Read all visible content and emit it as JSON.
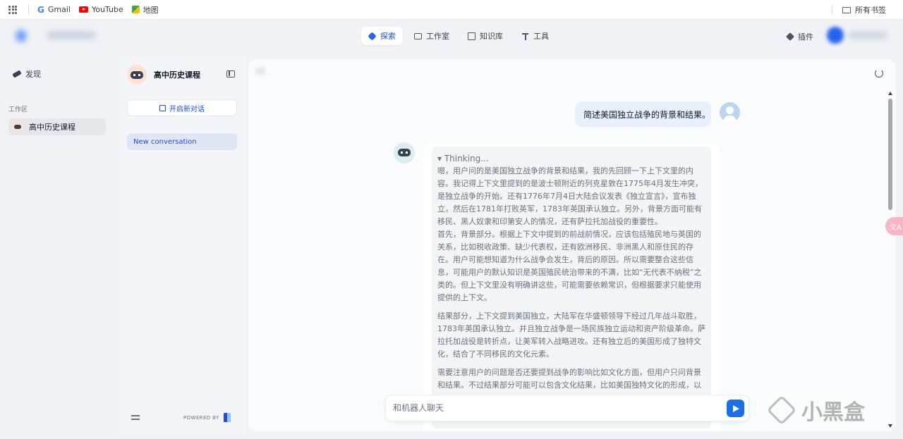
{
  "bookmarks": {
    "items": [
      {
        "label": "Gmail",
        "icon": "gmail-icon"
      },
      {
        "label": "YouTube",
        "icon": "youtube-icon"
      },
      {
        "label": "地图",
        "icon": "maps-icon"
      }
    ],
    "all_bookmarks": "所有书签"
  },
  "nav": {
    "explore": "探索",
    "studio": "工作室",
    "knowledge": "知识库",
    "tools": "工具",
    "plugins": "插件"
  },
  "sidebar": {
    "discover": "发现",
    "workspace_label": "工作区",
    "workspace_app": "高中历史课程"
  },
  "conversations": {
    "app_title": "高中历史课程",
    "new_chat": "开启新对话",
    "items": [
      "New conversation"
    ],
    "powered_by": "POWERED BY"
  },
  "chat": {
    "user_message": "简述美国独立战争的背景和结果。",
    "thinking_toggle": "▾ Thinking...",
    "thinking_paragraphs": [
      "嗯，用户问的是美国独立战争的背景和结果，我的先回顾一下上下文里的内容。我记得上下文里提到的是波士顿附近的列克星敦在1775年4月发生冲突，是独立战争的开始。还有1776年7月4日大陆会议发表《独立宣言》，宣布独立，然后在1781年打败英军，1783年英国承认独立。另外，背景方面可能有移民、黑人奴隶和印第安人的情况，还有萨拉托加战役的重要性。",
      "首先，背景部分。根据上下文中提到的前战前情况，应该包括殖民地与英国的关系，比如税收政策、缺少代表权，还有欧洲移民、非洲黑人和原住民的存在。用户可能想知道为什么战争会发生，背后的原因。所以需要整合这些信息，可能用户的默认知识是英国殖民统治带来的不满，比如“无代表不纳税”之类的。但上下文里没有明确讲这些，可能需要依赖常识，但根据要求只能使用提供的上下文。",
      "结果部分，上下文提到美国独立，大陆军在华盛顿领导下经过几年战斗取胜，1783年英国承认独立。并且独立战争是一场民族独立运动和资产阶级革命。萨拉托加战役是转折点，让美军转入战略进攻。还有独立后的美国形成了独特文化，结合了不同移民的文化元素。",
      "需要注意用户的问题是否还要提到战争的影响比如文化方面，但用户只问背景和结果。不过结果部分可能可以包含文化结果，比如美国独特文化的形成，以"
    ],
    "input_placeholder": "和机器人聊天"
  },
  "widgets": {
    "translate": "文A"
  },
  "watermark": {
    "text": "小黑盒"
  }
}
